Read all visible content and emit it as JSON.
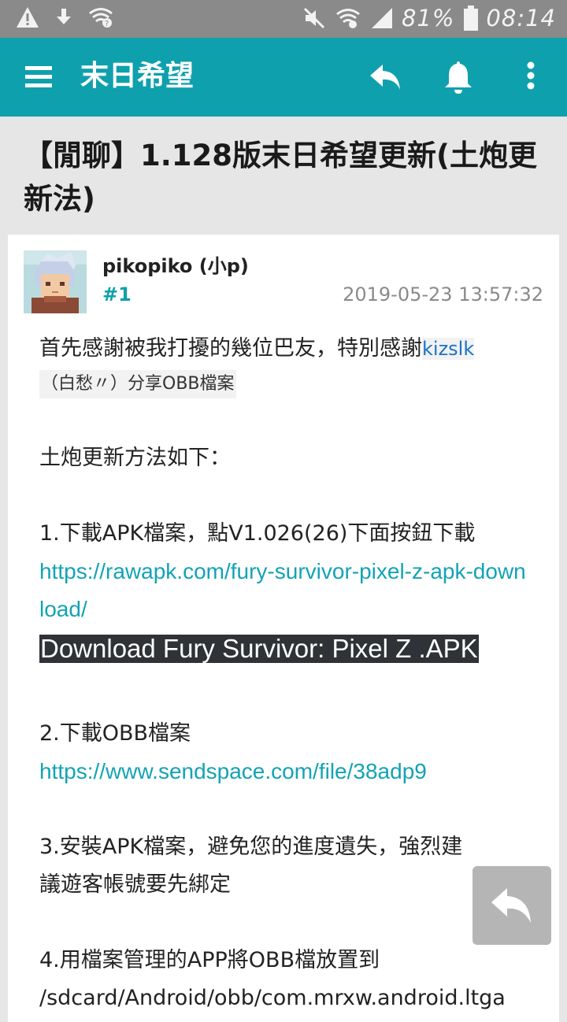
{
  "status_bar": {
    "battery": "81%",
    "time": "08:14",
    "icons": [
      "warning-icon",
      "download-icon",
      "wifi-question-icon",
      "mute-icon",
      "wifi-icon",
      "signal-icon",
      "battery-icon"
    ]
  },
  "app_bar": {
    "title": "末日希望",
    "icons": [
      "menu-icon",
      "reply-icon",
      "bell-icon",
      "more-vert-icon"
    ],
    "color": "#0fa0ad"
  },
  "thread": {
    "title": "【閒聊】1.128版末日希望更新(土炮更新法)"
  },
  "post": {
    "username": "pikopiko (小p)",
    "floor": "#1",
    "timestamp": "2019-05-23 13:57:32",
    "intro": "首先感謝被我打擾的幾位巴友，特別感謝",
    "mention_user": "kizslk",
    "mention_sub": "（白愁〃）分享OBB檔案",
    "method_heading": "土炮更新方法如下：",
    "step1_text": "1.下載APK檔案，點V1.026(26)下面按鈕下載",
    "step1_link": "https://rawapk.com/fury-survivor-pixel-z-apk-download/",
    "download_button": "Download Fury Survivor: Pixel Z .APK",
    "step2_text": "2.下載OBB檔案",
    "step2_link": "https://www.sendspace.com/file/38adp9",
    "step3_line1": "3.安裝APK檔案，避免您的進度遺失，強烈建",
    "step3_line2": "議遊客帳號要先綁定",
    "step4_line1": "4.用檔案管理的APP將OBB檔放置到",
    "step4_line2": "/sdcard/Android/obb/com.mrxw.android.ltga"
  }
}
